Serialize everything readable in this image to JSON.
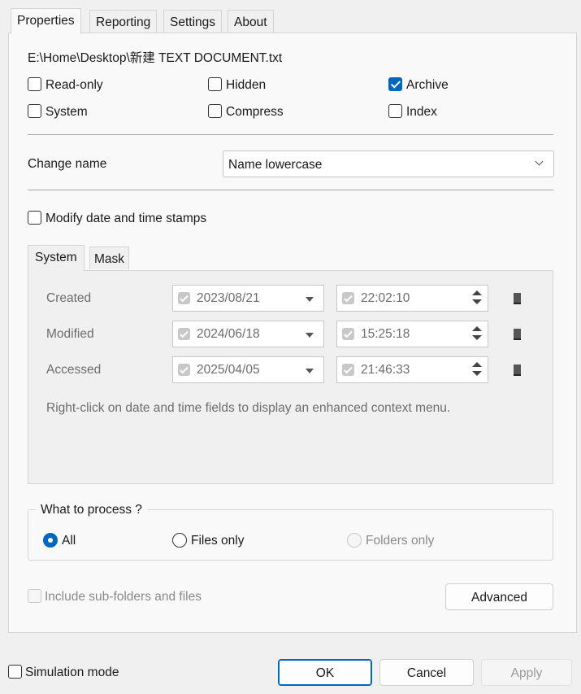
{
  "tabs": [
    {
      "label": "Properties"
    },
    {
      "label": "Reporting"
    },
    {
      "label": "Settings"
    },
    {
      "label": "About"
    }
  ],
  "file_path": "E:\\Home\\Desktop\\新建 TEXT DOCUMENT.txt",
  "attributes": {
    "read_only": {
      "label": "Read-only",
      "checked": false
    },
    "hidden": {
      "label": "Hidden",
      "checked": false
    },
    "archive": {
      "label": "Archive",
      "checked": true
    },
    "system": {
      "label": "System",
      "checked": false
    },
    "compress": {
      "label": "Compress",
      "checked": false
    },
    "index": {
      "label": "Index",
      "checked": false
    }
  },
  "change_name": {
    "label": "Change name",
    "selected": "Name lowercase"
  },
  "modify_dates": {
    "label": "Modify date and time stamps",
    "checked": false
  },
  "date_tabs": [
    {
      "label": "System"
    },
    {
      "label": "Mask"
    }
  ],
  "timestamps": [
    {
      "label": "Created",
      "date": "2023/08/21",
      "time": "22:02:10"
    },
    {
      "label": "Modified",
      "date": "2024/06/18",
      "time": "15:25:18"
    },
    {
      "label": "Accessed",
      "date": "2025/04/05",
      "time": "21:46:33"
    }
  ],
  "hint": "Right-click on date and time fields to display an enhanced context menu.",
  "process": {
    "title": "What to process ?",
    "options": [
      {
        "label": "All",
        "selected": true,
        "enabled": true
      },
      {
        "label": "Files only",
        "selected": false,
        "enabled": true
      },
      {
        "label": "Folders only",
        "selected": false,
        "enabled": false
      }
    ]
  },
  "include_subfolders": {
    "label": "Include sub-folders and files",
    "checked": false,
    "enabled": false
  },
  "advanced_label": "Advanced",
  "simulation_mode": {
    "label": "Simulation mode",
    "checked": false
  },
  "footer": {
    "ok_label": "OK",
    "cancel_label": "Cancel",
    "apply_label": "Apply"
  },
  "colors": {
    "accent": "#0067c0",
    "disabled_text": "#8a8a8a"
  }
}
